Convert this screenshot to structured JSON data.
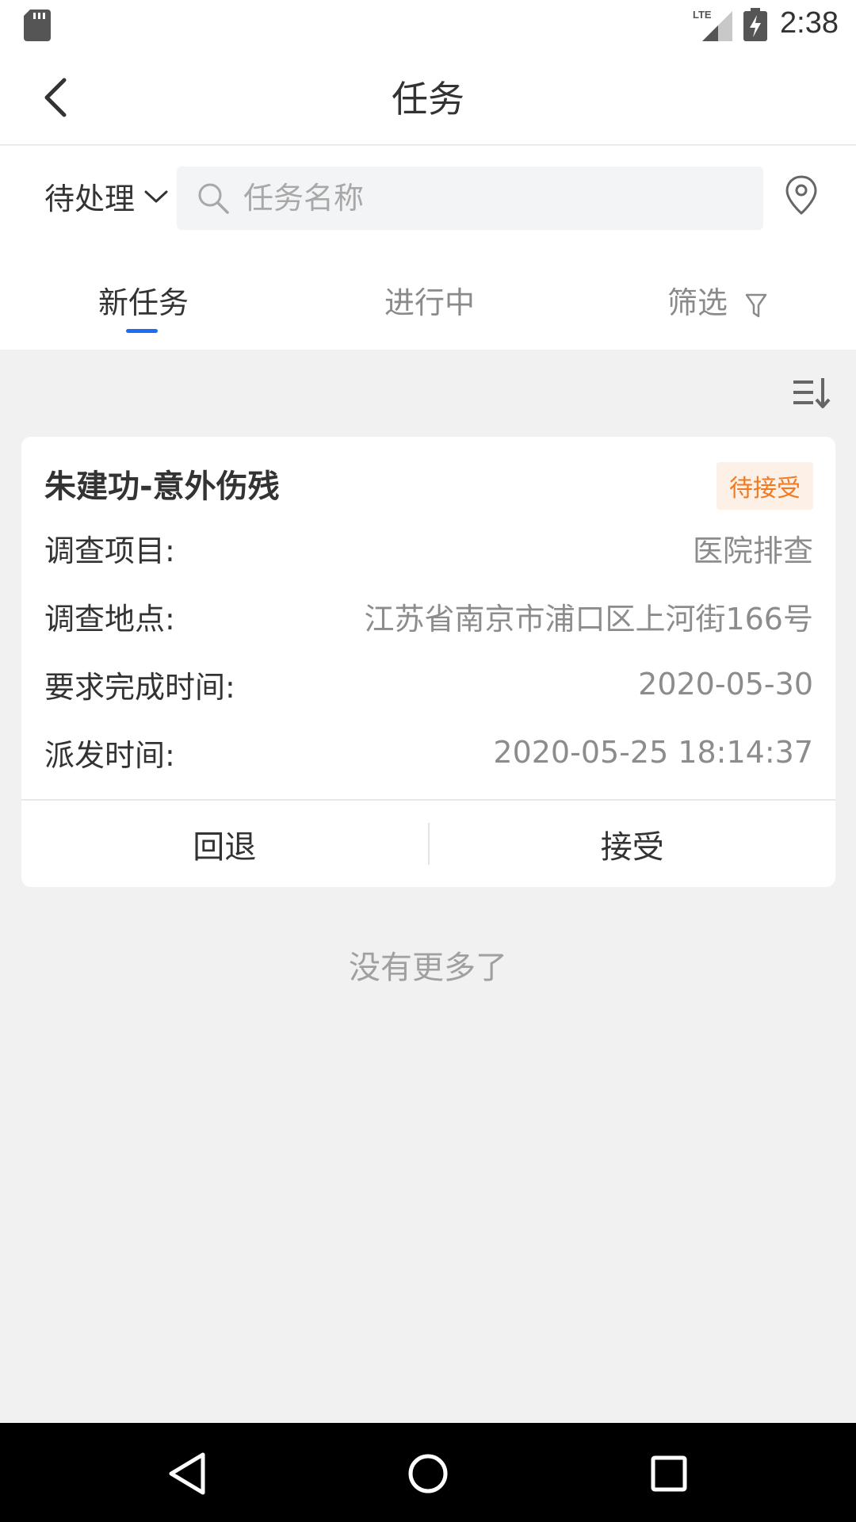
{
  "statusbar": {
    "network": "LTE",
    "time": "2:38"
  },
  "header": {
    "title": "任务"
  },
  "search": {
    "status_filter": "待处理",
    "placeholder": "任务名称"
  },
  "tabs": [
    {
      "label": "新任务",
      "active": true
    },
    {
      "label": "进行中",
      "active": false
    },
    {
      "label": "筛选",
      "active": false
    }
  ],
  "tasks": [
    {
      "title": "朱建功-意外伤残",
      "status": "待接受",
      "fields": [
        {
          "label": "调查项目:",
          "value": "医院排查"
        },
        {
          "label": "调查地点:",
          "value": "江苏省南京市浦口区上河街166号"
        },
        {
          "label": "要求完成时间:",
          "value": "2020-05-30"
        },
        {
          "label": "派发时间:",
          "value": "2020-05-25 18:14:37"
        }
      ],
      "actions": {
        "reject": "回退",
        "accept": "接受"
      }
    }
  ],
  "list_footer": "没有更多了",
  "colors": {
    "accent": "#1e6cf0",
    "badge_text": "#f07a22",
    "badge_bg": "#fdf0e6",
    "background": "#f1f1f1"
  },
  "icons": [
    "sd-card-icon",
    "lte-signal-icon",
    "battery-charging-icon",
    "back-arrow-icon",
    "chevron-down-icon",
    "search-icon",
    "location-pin-icon",
    "filter-icon",
    "sort-icon",
    "nav-back-icon",
    "nav-home-icon",
    "nav-recents-icon"
  ]
}
